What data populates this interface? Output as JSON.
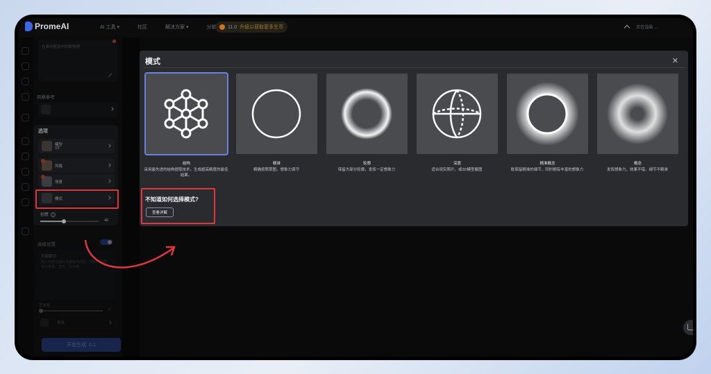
{
  "brand": {
    "name": "PromeAI"
  },
  "topnav": {
    "items": [
      "AI 工具 ▾",
      "社区",
      "解决方案 ▾",
      "分销"
    ],
    "credits": "11.0",
    "upgrade": "升级以获取更多生币",
    "status": "正在渲染 …"
  },
  "panel": {
    "prompt_placeholder": "在画中框选中的数物理",
    "style_ref_label": "风格参考",
    "options_title": "选项",
    "rows": [
      {
        "label": "模型",
        "sub": "V2"
      },
      {
        "label": "风格",
        "sub": ""
      },
      {
        "label": "场景",
        "sub": ""
      },
      {
        "label": "模式",
        "sub": ""
      }
    ],
    "creativity_label": "创意",
    "creativity_value": 40,
    "creativity_display": "40",
    "advanced_label": "高级设置",
    "negative_label": "负面提词",
    "negative_hint": "输入你想在图片中避免的内容，例如：模糊、低分辨率、变形、文字等。",
    "art_label": "艺术性",
    "art_value": "0",
    "view_label": "视角",
    "generate_label": "开始生成",
    "generate_cost": "0.1"
  },
  "modal": {
    "title": "模式",
    "close": "✕",
    "modes": [
      {
        "name": "结构",
        "desc": "采用最先进的结构提取技术，生成超高精度的最佳结果。",
        "icon": "structure-icon",
        "selected": true
      },
      {
        "name": "精准",
        "desc": "精确按照草图，想象力保守",
        "icon": "circle-outline-icon",
        "selected": false
      },
      {
        "name": "轮廓",
        "desc": "保留大部分轮廓，发挥一定想象力",
        "icon": "soft-sphere-icon",
        "selected": false
      },
      {
        "name": "深度",
        "desc": "适合现实照片，或3D模型截图",
        "icon": "globe-icon",
        "selected": false
      },
      {
        "name": "精准概念",
        "desc": "既保留精准的细节，同时拥有丰富的想象力",
        "icon": "glow-ring-icon",
        "selected": false
      },
      {
        "name": "概念",
        "desc": "发挥想象力，效果不错，细节不精准",
        "icon": "blur-ring-icon",
        "selected": false
      }
    ],
    "help_text": "不知道如何选择模式?",
    "help_button": "查看详解"
  },
  "colors": {
    "highlight": "#e0373f",
    "accent": "#2f5bd3",
    "modal_bg": "#2a2b2f"
  }
}
